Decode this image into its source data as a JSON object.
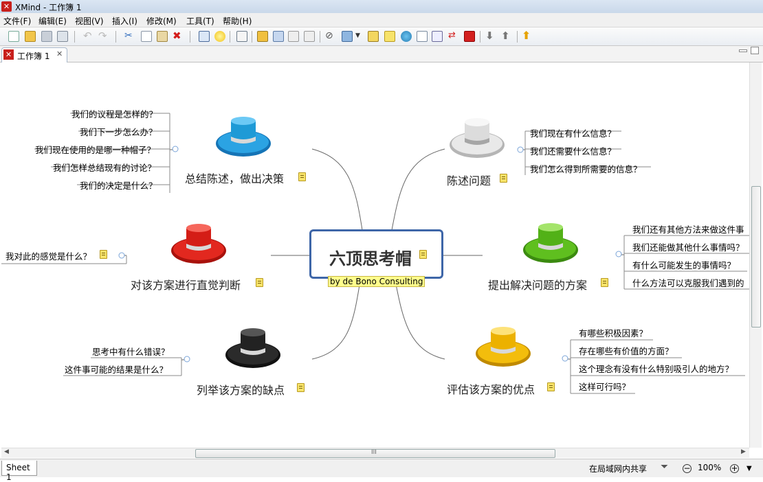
{
  "window": {
    "title": "XMind - 工作簿 1"
  },
  "menu": [
    "文件(F)",
    "编辑(E)",
    "视图(V)",
    "插入(I)",
    "修改(M)",
    "工具(T)",
    "帮助(H)"
  ],
  "tab": {
    "label": "工作簿 1"
  },
  "map": {
    "central": {
      "title": "六顶思考帽",
      "label": "by de Bono Consulting"
    },
    "topics": [
      {
        "title": "总结陈述，做出决策",
        "hat": "blue-hat-icon",
        "color": "#1e9ad6",
        "subs": [
          "我们的议程是怎样的？",
          "我们下一步怎么办？",
          "我们现在使用的是哪一种帽子？",
          "我们怎样总结现有的讨论？",
          "我们的决定是什么？"
        ]
      },
      {
        "title": "陈述问题",
        "hat": "white-hat-icon",
        "color": "#e6e6e6",
        "subs": [
          "我们现在有什么信息？",
          "我们还需要什么信息？",
          "我们怎么得到所需要的信息？"
        ]
      },
      {
        "title": "对该方案进行直觉判断",
        "hat": "red-hat-icon",
        "color": "#e0241c",
        "subs": [
          "我对此的感觉是什么？"
        ]
      },
      {
        "title": "提出解决问题的方案",
        "hat": "green-hat-icon",
        "color": "#5ab81c",
        "subs": [
          "我们还有其他方法来做这件事",
          "我们还能做其他什么事情吗？",
          "有什么可能发生的事情吗？",
          "什么方法可以克服我们遇到的"
        ]
      },
      {
        "title": "列举该方案的缺点",
        "hat": "black-hat-icon",
        "color": "#222222",
        "subs": [
          "思考中有什么错误？",
          "这件事可能的结果是什么？"
        ]
      },
      {
        "title": "评估该方案的优点",
        "hat": "yellow-hat-icon",
        "color": "#f1b400",
        "subs": [
          "有哪些积极因素？",
          "存在哪些有价值的方面？",
          "这个理念有没有什么特别吸引人的地方？",
          "这样可行吗？"
        ]
      }
    ]
  },
  "hscroll_label": "III",
  "status": {
    "sheet": "Sheet 1",
    "share": "在局域网内共享",
    "zoom": "100%"
  }
}
